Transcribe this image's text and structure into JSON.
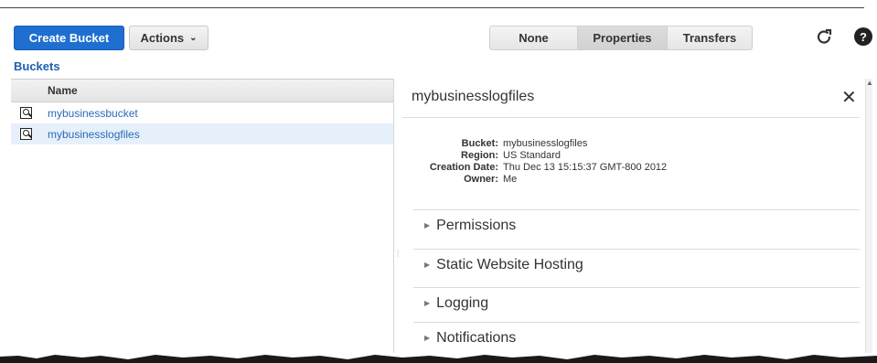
{
  "toolbar": {
    "create_bucket": "Create Bucket",
    "actions": "Actions",
    "view_modes": [
      "None",
      "Properties",
      "Transfers"
    ],
    "active_mode": "Properties",
    "help": "?"
  },
  "buckets": {
    "title": "Buckets",
    "column_name": "Name",
    "items": [
      {
        "name": "mybusinessbucket",
        "selected": false
      },
      {
        "name": "mybusinesslogfiles",
        "selected": true
      }
    ]
  },
  "properties": {
    "title": "mybusinesslogfiles",
    "fields": [
      {
        "key": "Bucket:",
        "value": "mybusinesslogfiles"
      },
      {
        "key": "Region:",
        "value": "US Standard"
      },
      {
        "key": "Creation Date:",
        "value": "Thu Dec 13 15:15:37 GMT-800 2012"
      },
      {
        "key": "Owner:",
        "value": "Me"
      }
    ],
    "sections": [
      "Permissions",
      "Static Website Hosting",
      "Logging",
      "Notifications"
    ]
  },
  "colors": {
    "primary": "#1f6fd0",
    "link": "#2a6ab8",
    "selected_row": "#e6f0fa"
  }
}
